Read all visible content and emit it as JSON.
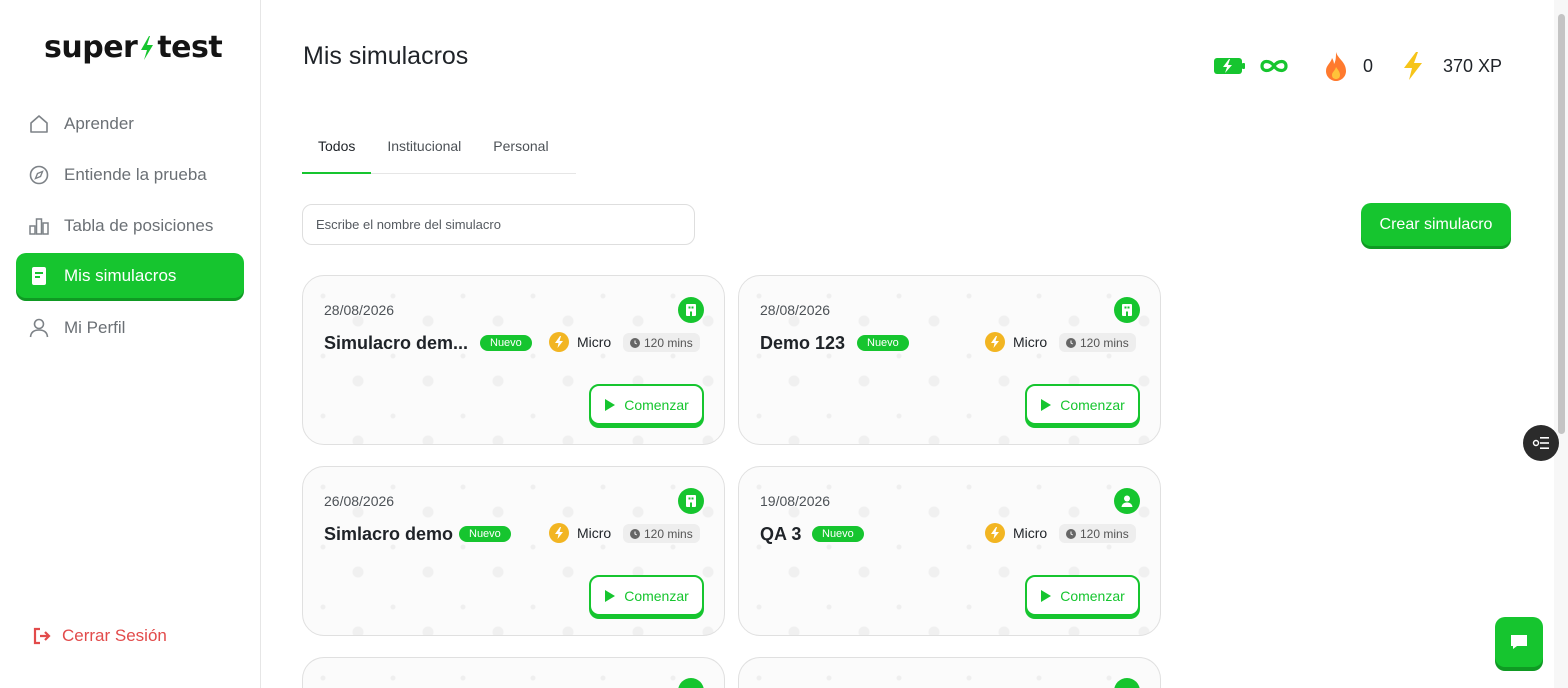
{
  "brand": {
    "name_left": "super",
    "name_right": "test",
    "accent": "#16c52f"
  },
  "sidebar": {
    "items": [
      {
        "label": "Aprender",
        "icon": "home-icon"
      },
      {
        "label": "Entiende la prueba",
        "icon": "compass-icon"
      },
      {
        "label": "Tabla de posiciones",
        "icon": "chart-icon"
      },
      {
        "label": "Mis simulacros",
        "icon": "document-icon",
        "active": true
      },
      {
        "label": "Mi Perfil",
        "icon": "user-icon"
      }
    ],
    "logout_label": "Cerrar Sesión"
  },
  "header": {
    "title": "Mis simulacros",
    "stats": {
      "streak": "0",
      "xp": "370 XP"
    }
  },
  "tabs": [
    {
      "label": "Todos",
      "active": true
    },
    {
      "label": "Institucional"
    },
    {
      "label": "Personal"
    }
  ],
  "search": {
    "placeholder": "Escribe el nombre del simulacro"
  },
  "create_button": "Crear simulacro",
  "cards": [
    {
      "date": "28/08/2026",
      "name": "Simulacro dem...",
      "badge": "Nuevo",
      "kind": "Micro",
      "duration": "120 mins",
      "action": "Comenzar",
      "type_icon": "building-icon"
    },
    {
      "date": "28/08/2026",
      "name": "Demo 123",
      "badge": "Nuevo",
      "kind": "Micro",
      "duration": "120 mins",
      "action": "Comenzar",
      "type_icon": "building-icon"
    },
    {
      "date": "26/08/2026",
      "name": "Simlacro demo",
      "badge": "Nuevo",
      "kind": "Micro",
      "duration": "120 mins",
      "action": "Comenzar",
      "type_icon": "building-icon"
    },
    {
      "date": "19/08/2026",
      "name": "QA 3",
      "badge": "Nuevo",
      "kind": "Micro",
      "duration": "120 mins",
      "action": "Comenzar",
      "type_icon": "person-icon"
    }
  ]
}
